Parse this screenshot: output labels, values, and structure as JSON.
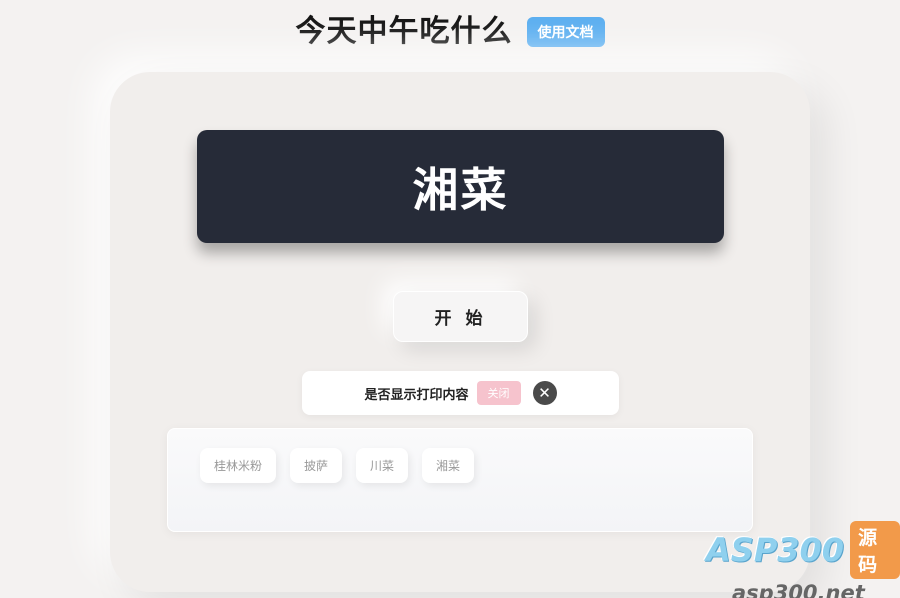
{
  "header": {
    "title": "今天中午吃什么",
    "doc_button": "使用文档"
  },
  "result": {
    "text": "湘菜"
  },
  "start_button": "开 始",
  "print_setting": {
    "label": "是否显示打印内容",
    "toggle": "关闭",
    "close_glyph": "✕"
  },
  "options": [
    {
      "label": "桂林米粉"
    },
    {
      "label": "披萨"
    },
    {
      "label": "川菜"
    },
    {
      "label": "湘菜"
    }
  ],
  "watermark": {
    "brand": "ASP300",
    "badge": "源码",
    "url": "asp300.net"
  },
  "colors": {
    "doc_button": "#5aaef0",
    "result_bg": "#262b38",
    "toggle_bg": "#f6c3cd",
    "watermark_badge": "#f29a4a"
  }
}
